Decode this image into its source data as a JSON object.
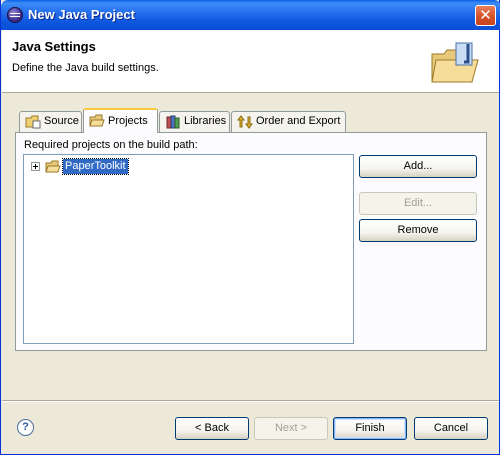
{
  "window": {
    "title": "New Java Project"
  },
  "header": {
    "title": "Java Settings",
    "description": "Define the Java build settings."
  },
  "tabs": [
    {
      "label": "Source",
      "icon": "source-folder-icon",
      "active": false
    },
    {
      "label": "Projects",
      "icon": "projects-folder-icon",
      "active": true
    },
    {
      "label": "Libraries",
      "icon": "libraries-icon",
      "active": false
    },
    {
      "label": "Order and Export",
      "icon": "order-export-icon",
      "active": false
    }
  ],
  "projects_panel": {
    "label": "Required projects on the build path:",
    "tree_items": [
      {
        "label": "PaperToolkit",
        "icon": "project-folder-icon",
        "selected": true,
        "expandable": true
      }
    ],
    "buttons": {
      "add": "Add...",
      "edit": "Edit...",
      "remove": "Remove"
    }
  },
  "footer": {
    "back": "< Back",
    "next": "Next >",
    "finish": "Finish",
    "cancel": "Cancel",
    "help": "?"
  },
  "colors": {
    "titlebar": "#0a5ee6",
    "selection": "#316ac5",
    "active_tab_accent": "#ffc83c",
    "dialog_bg": "#ece9d8"
  }
}
